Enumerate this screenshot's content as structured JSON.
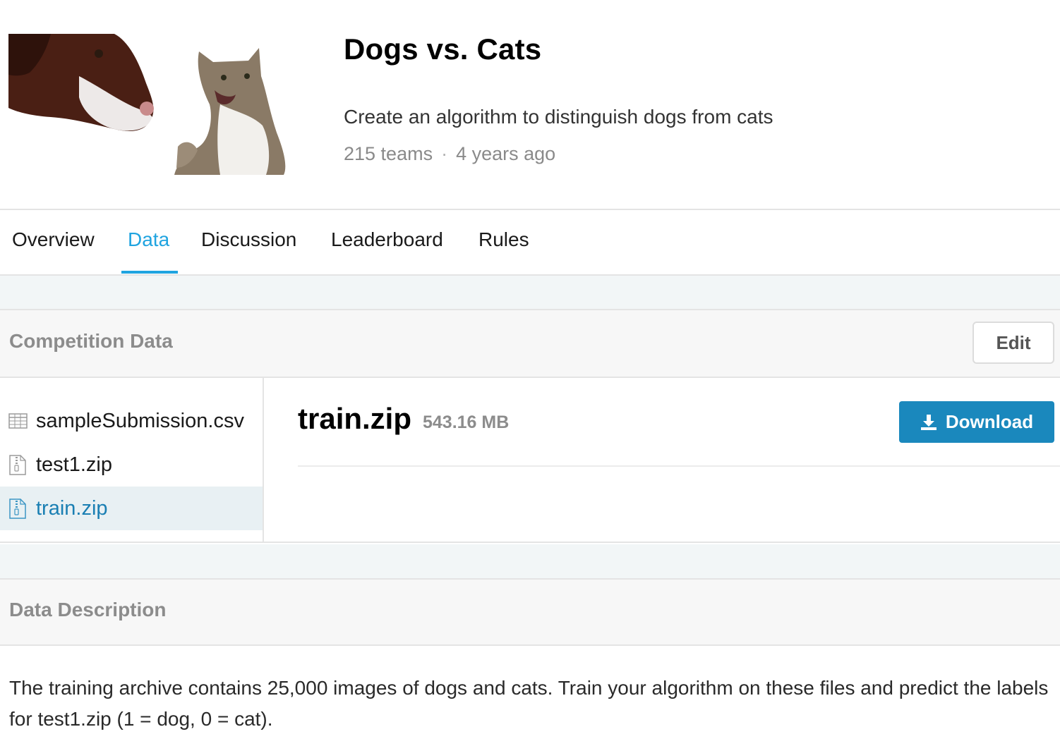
{
  "competition": {
    "title": "Dogs vs. Cats",
    "subtitle": "Create an algorithm to distinguish dogs from cats",
    "teams": "215 teams",
    "separator": "·",
    "age": "4 years ago"
  },
  "tabs": [
    {
      "label": "Overview",
      "active": false
    },
    {
      "label": "Data",
      "active": true
    },
    {
      "label": "Discussion",
      "active": false
    },
    {
      "label": "Leaderboard",
      "active": false
    },
    {
      "label": "Rules",
      "active": false
    }
  ],
  "competition_data": {
    "heading": "Competition Data",
    "edit_label": "Edit",
    "files": [
      {
        "name": "sampleSubmission.csv",
        "icon": "table-icon",
        "active": false
      },
      {
        "name": "test1.zip",
        "icon": "zip-file-icon",
        "active": false
      },
      {
        "name": "train.zip",
        "icon": "zip-file-icon",
        "active": true
      }
    ],
    "selected": {
      "name": "train.zip",
      "size": "543.16 MB",
      "download_label": "Download"
    }
  },
  "data_description": {
    "heading": "Data Description",
    "text": "The training archive contains 25,000 images of dogs and cats. Train your algorithm on these files and predict the labels for test1.zip (1 = dog, 0 = cat)."
  },
  "colors": {
    "accent": "#20a4e0",
    "download": "#1a88bd",
    "active_file": "#1a7fb3"
  }
}
